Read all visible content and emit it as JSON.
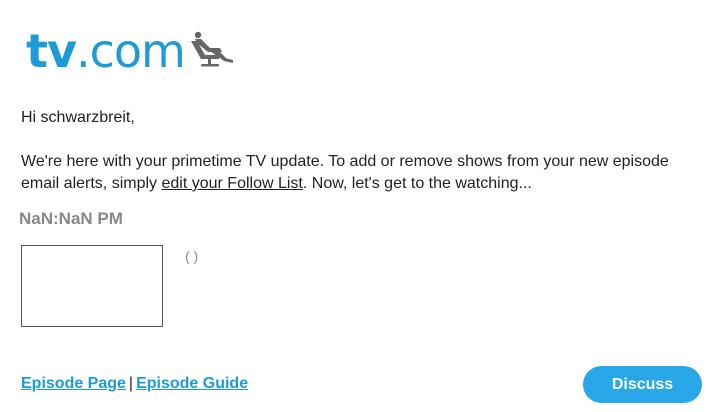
{
  "logo": {
    "tv": "tv",
    "dotcom": ".com",
    "icon": "reclining-chair-person-icon",
    "brand_color": "#1d9bd8"
  },
  "email": {
    "greeting": "Hi schwarzbreit,",
    "intro_before_link": "We're here with your primetime TV update. To add or remove shows from your new episode email alerts, simply ",
    "intro_link": "edit your Follow List",
    "intro_after_link": ". Now, let's get to the watching..."
  },
  "episode": {
    "airtime": "NaN:NaN PM",
    "meta": "( )"
  },
  "links": {
    "episode_page": "Episode Page",
    "separator": "|",
    "episode_guide": "Episode Guide"
  },
  "discuss_button": {
    "label": "Discuss",
    "color": "#28a8e8"
  }
}
